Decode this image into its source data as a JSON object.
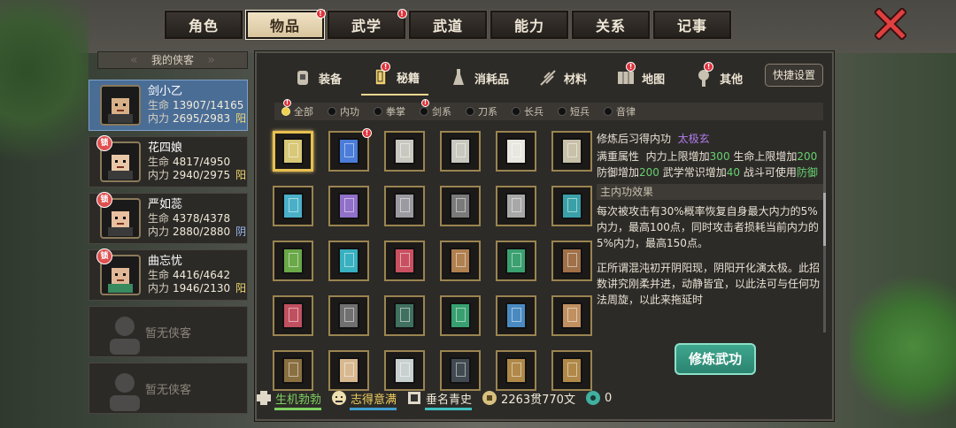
{
  "top_tabs": [
    {
      "label": "角色",
      "active": false,
      "badge": false
    },
    {
      "label": "物品",
      "active": true,
      "badge": true
    },
    {
      "label": "武学",
      "active": false,
      "badge": true
    },
    {
      "label": "武道",
      "active": false,
      "badge": false
    },
    {
      "label": "能力",
      "active": false,
      "badge": false
    },
    {
      "label": "关系",
      "active": false,
      "badge": false
    },
    {
      "label": "记事",
      "active": false,
      "badge": false
    }
  ],
  "badge_mark": "!",
  "roster": {
    "title": "我的侠客",
    "lock_mark": "锁",
    "hp_label": "生命",
    "mp_label": "内力",
    "heroes": [
      {
        "name": "剑小乙",
        "hp": "13907/14165",
        "mp": "2695/2983",
        "attr": "阳",
        "active": true
      },
      {
        "name": "花四娘",
        "hp": "4817/4950",
        "mp": "2940/2975",
        "attr": "阳",
        "active": false
      },
      {
        "name": "严如蕊",
        "hp": "4378/4378",
        "mp": "2880/2880",
        "attr": "阴",
        "active": false
      },
      {
        "name": "曲忘忧",
        "hp": "4416/4642",
        "mp": "1946/2130",
        "attr": "阳",
        "active": false
      }
    ],
    "empty_slots": [
      "暂无侠客",
      "暂无侠客"
    ]
  },
  "category_tabs": [
    {
      "label": "装备",
      "icon": "armor-icon",
      "active": false,
      "badge": false
    },
    {
      "label": "秘籍",
      "icon": "book-icon",
      "active": true,
      "badge": true
    },
    {
      "label": "消耗品",
      "icon": "potion-icon",
      "active": false,
      "badge": false
    },
    {
      "label": "材料",
      "icon": "herb-icon",
      "active": false,
      "badge": false
    },
    {
      "label": "地图",
      "icon": "map-icon",
      "active": false,
      "badge": true
    },
    {
      "label": "其他",
      "icon": "misc-icon",
      "active": false,
      "badge": true
    }
  ],
  "quick_settings": "快捷设置",
  "filters": [
    {
      "label": "全部",
      "active": true,
      "badge": true
    },
    {
      "label": "内功",
      "active": false,
      "badge": false
    },
    {
      "label": "拳掌",
      "active": false,
      "badge": false
    },
    {
      "label": "剑系",
      "active": false,
      "badge": true
    },
    {
      "label": "刀系",
      "active": false,
      "badge": false
    },
    {
      "label": "长兵",
      "active": false,
      "badge": false
    },
    {
      "label": "短兵",
      "active": false,
      "badge": false
    },
    {
      "label": "音律",
      "active": false,
      "badge": false
    }
  ],
  "items": [
    {
      "color": "#d8c878",
      "selected": true,
      "badge": false
    },
    {
      "color": "#4a7cd8",
      "selected": false,
      "badge": true
    },
    {
      "color": "#c8c8c0",
      "selected": false,
      "badge": false
    },
    {
      "color": "#c8c8c0",
      "selected": false,
      "badge": false
    },
    {
      "color": "#e8e8e0",
      "selected": false,
      "badge": false
    },
    {
      "color": "#c8c0a8",
      "selected": false,
      "badge": false
    },
    {
      "color": "#4ab0c8",
      "selected": false,
      "badge": false
    },
    {
      "color": "#9070c8",
      "selected": false,
      "badge": false
    },
    {
      "color": "#9a9aa0",
      "selected": false,
      "badge": false
    },
    {
      "color": "#7a7a7a",
      "selected": false,
      "badge": false
    },
    {
      "color": "#a8a8a8",
      "selected": false,
      "badge": false
    },
    {
      "color": "#3aa0a8",
      "selected": false,
      "badge": false
    },
    {
      "color": "#6aa848",
      "selected": false,
      "badge": false
    },
    {
      "color": "#38b0c0",
      "selected": false,
      "badge": false
    },
    {
      "color": "#c85060",
      "selected": false,
      "badge": false
    },
    {
      "color": "#b08050",
      "selected": false,
      "badge": false
    },
    {
      "color": "#3aa070",
      "selected": false,
      "badge": false
    },
    {
      "color": "#a07048",
      "selected": false,
      "badge": false
    },
    {
      "color": "#c05060",
      "selected": false,
      "badge": false
    },
    {
      "color": "#707070",
      "selected": false,
      "badge": false
    },
    {
      "color": "#407060",
      "selected": false,
      "badge": false
    },
    {
      "color": "#38a070",
      "selected": false,
      "badge": false
    },
    {
      "color": "#4a8ac0",
      "selected": false,
      "badge": false
    },
    {
      "color": "#c09060",
      "selected": false,
      "badge": false
    },
    {
      "color": "#8a7040",
      "selected": false,
      "badge": false
    },
    {
      "color": "#d8b890",
      "selected": false,
      "badge": false
    },
    {
      "color": "#c8d0d0",
      "selected": false,
      "badge": false
    },
    {
      "color": "#404a50",
      "selected": false,
      "badge": false
    },
    {
      "color": "#b08848",
      "selected": false,
      "badge": false
    },
    {
      "color": "#b08848",
      "selected": false,
      "badge": false
    }
  ],
  "detail": {
    "learn_label": "修炼后习得内功",
    "learn_value": "太极玄",
    "attr_label": "满重属性",
    "attr_parts": [
      {
        "t": "内力上限增加",
        "c": "lbl"
      },
      {
        "t": "300",
        "c": "g"
      },
      {
        "t": " 生命上限增加",
        "c": "lbl"
      },
      {
        "t": "200",
        "c": "g"
      },
      {
        "t": " 防御增加",
        "c": "lbl"
      },
      {
        "t": "200",
        "c": "g"
      },
      {
        "t": " 武学常识增加",
        "c": "lbl"
      },
      {
        "t": "40",
        "c": "g"
      },
      {
        "t": " 战斗可使用",
        "c": "lbl"
      },
      {
        "t": "防御",
        "c": "g"
      }
    ],
    "section_title": "主内功效果",
    "effect": "每次被攻击有30%概率恢复自身最大内力的5%内力，最高100点，同时攻击者损耗当前内力的5%内力，最高150点。",
    "description": "正所谓混沌初开阴阳现，阴阳开化演太极。此招数讲究刚柔并进，动静皆宜，以此法可与任何功法周旋，以此来拖延时"
  },
  "train_button": "修炼武功",
  "status": [
    {
      "label": "生机勃勃",
      "icon": "vitality-icon",
      "cls": "c-green",
      "bar": "#7ed060"
    },
    {
      "label": "志得意满",
      "icon": "mood-icon",
      "cls": "c-yellow",
      "bar": "#40a0d0"
    },
    {
      "label": "垂名青史",
      "icon": "fame-icon",
      "cls": "c-white",
      "bar": "#40c0c0"
    },
    {
      "label": "2263贯770文",
      "icon": "coin-icon",
      "cls": "c-white",
      "bar": ""
    },
    {
      "label": "0",
      "icon": "jade-icon",
      "cls": "c-white",
      "bar": ""
    }
  ]
}
